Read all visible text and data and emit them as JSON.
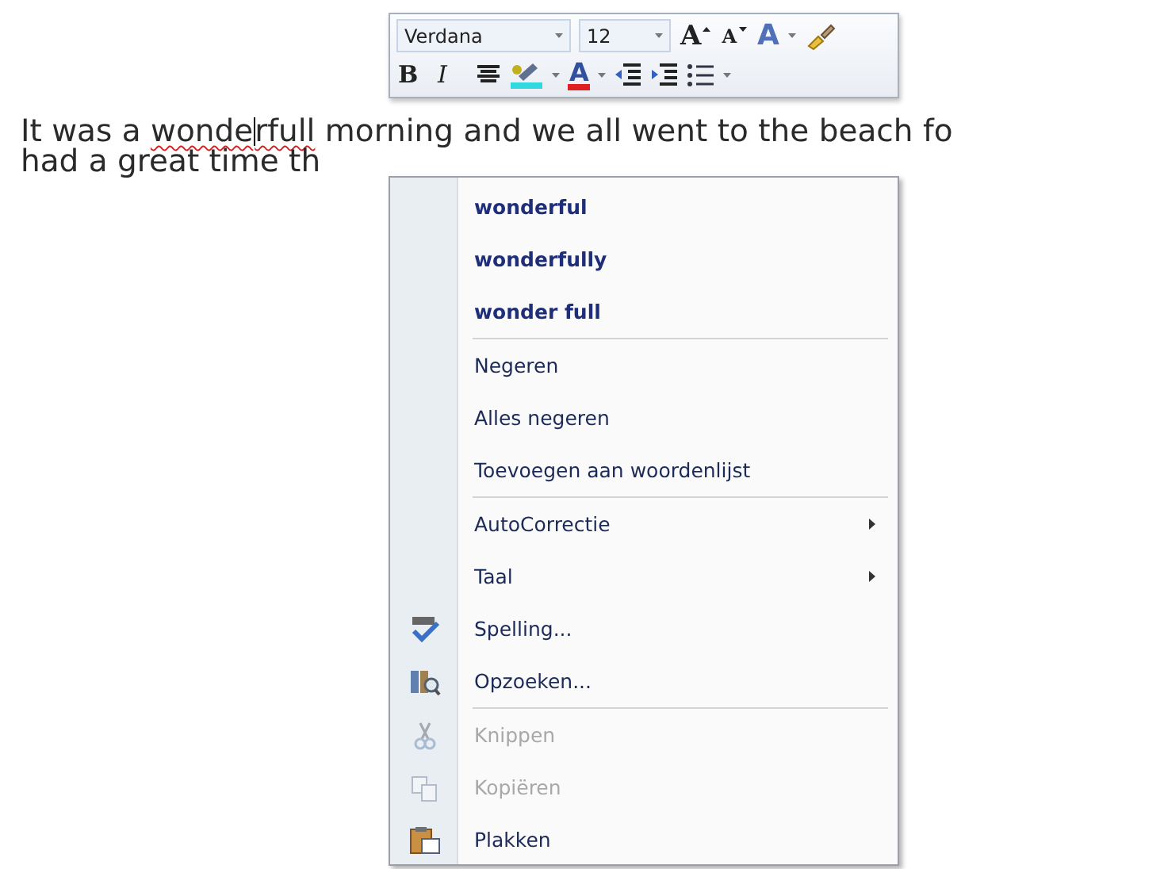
{
  "document": {
    "lines": [
      {
        "segments": [
          {
            "kind": "text",
            "text": "It was a "
          },
          {
            "kind": "misspelled",
            "text": "wonde"
          },
          {
            "kind": "caret"
          },
          {
            "kind": "misspelled",
            "text": "rfull"
          },
          {
            "kind": "text",
            "text": " morning and we all went to the beach fo"
          }
        ]
      },
      {
        "segments": [
          {
            "kind": "text",
            "text": "had a great time th"
          }
        ]
      }
    ]
  },
  "mini_toolbar": {
    "top_row": [
      {
        "kind": "font-name",
        "value": "Verdana",
        "dropdown": true
      },
      {
        "kind": "font-size",
        "value": "12",
        "dropdown": true
      },
      {
        "kind": "grow-font",
        "label": "A",
        "dropdown": false
      },
      {
        "kind": "shrink-font",
        "label": "A",
        "dropdown": false
      },
      {
        "kind": "styles",
        "label": "A",
        "dropdown": true
      },
      {
        "kind": "format-painter",
        "dropdown": false
      }
    ],
    "bottom_row": [
      {
        "kind": "bold",
        "label": "B",
        "dropdown": false
      },
      {
        "kind": "italic",
        "label": "I",
        "dropdown": false
      },
      {
        "kind": "center",
        "dropdown": false
      },
      {
        "kind": "highlight",
        "dropdown": true
      },
      {
        "kind": "font-color",
        "label": "A",
        "dropdown": true
      },
      {
        "kind": "outdent",
        "dropdown": false
      },
      {
        "kind": "indent",
        "dropdown": false
      },
      {
        "kind": "bullets",
        "dropdown": true
      }
    ]
  },
  "context_menu": {
    "items": [
      {
        "kind": "suggestion",
        "label": "wonderful",
        "submenu": false,
        "disabled": false
      },
      {
        "kind": "suggestion",
        "label": "wonderfully",
        "submenu": false,
        "disabled": false
      },
      {
        "kind": "suggestion",
        "label": "wonder full",
        "submenu": false,
        "disabled": false
      },
      {
        "kind": "separator"
      },
      {
        "kind": "plain",
        "label": "Negeren",
        "submenu": false,
        "disabled": false
      },
      {
        "kind": "plain",
        "label": "Alles negeren",
        "submenu": false,
        "disabled": false
      },
      {
        "kind": "plain",
        "label": "Toevoegen aan woordenlijst",
        "submenu": false,
        "disabled": false
      },
      {
        "kind": "separator"
      },
      {
        "kind": "plain",
        "label": "AutoCorrectie",
        "submenu": true,
        "disabled": false
      },
      {
        "kind": "plain",
        "label": "Taal",
        "submenu": true,
        "disabled": false
      },
      {
        "kind": "spelling",
        "label": "Spelling...",
        "submenu": false,
        "disabled": false
      },
      {
        "kind": "lookup",
        "label": "Opzoeken...",
        "submenu": false,
        "disabled": false
      },
      {
        "kind": "separator"
      },
      {
        "kind": "cut",
        "label": "Knippen",
        "submenu": false,
        "disabled": true
      },
      {
        "kind": "copy",
        "label": "Kopiëren",
        "submenu": false,
        "disabled": true
      },
      {
        "kind": "paste",
        "label": "Plakken",
        "submenu": false,
        "disabled": false
      }
    ]
  }
}
